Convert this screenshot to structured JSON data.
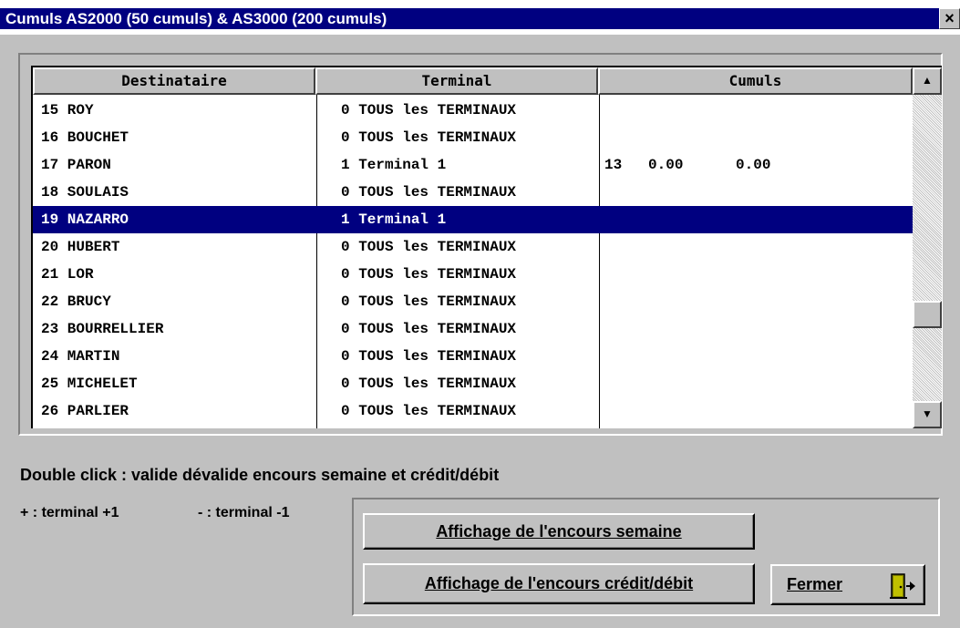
{
  "window": {
    "title": "Cumuls AS2000 (50 cumuls) & AS3000 (200 cumuls)",
    "close_glyph": "×"
  },
  "table": {
    "columns": [
      "Destinataire",
      "Terminal",
      "Cumuls"
    ],
    "rows": [
      {
        "dest": "15 ROY",
        "terminal": "0 TOUS les TERMINAUX",
        "cumuls": ""
      },
      {
        "dest": "16 BOUCHET",
        "terminal": "0 TOUS les TERMINAUX",
        "cumuls": ""
      },
      {
        "dest": "17 PARON",
        "terminal": "1 Terminal 1",
        "cumuls": "13   0.00      0.00"
      },
      {
        "dest": "18 SOULAIS",
        "terminal": "0 TOUS les TERMINAUX",
        "cumuls": ""
      },
      {
        "dest": "19 NAZARRO",
        "terminal": "1 Terminal 1",
        "cumuls": "",
        "selected": true
      },
      {
        "dest": "20 HUBERT",
        "terminal": "0 TOUS les TERMINAUX",
        "cumuls": ""
      },
      {
        "dest": "21 LOR",
        "terminal": "0 TOUS les TERMINAUX",
        "cumuls": ""
      },
      {
        "dest": "22 BRUCY",
        "terminal": "0 TOUS les TERMINAUX",
        "cumuls": ""
      },
      {
        "dest": "23 BOURRELLIER",
        "terminal": "0 TOUS les TERMINAUX",
        "cumuls": ""
      },
      {
        "dest": "24 MARTIN",
        "terminal": "0 TOUS les TERMINAUX",
        "cumuls": ""
      },
      {
        "dest": "25 MICHELET",
        "terminal": "0 TOUS les TERMINAUX",
        "cumuls": ""
      },
      {
        "dest": "26 PARLIER",
        "terminal": "0 TOUS les TERMINAUX",
        "cumuls": ""
      }
    ],
    "scroll_up_glyph": "▲",
    "scroll_down_glyph": "▼"
  },
  "hints": {
    "double_click": "Double click : valide dévalide encours semaine et crédit/débit",
    "plus": "+ : terminal +1",
    "minus": "- : terminal -1"
  },
  "buttons": {
    "encours_semaine": "Affichage de l'encours semaine",
    "encours_credit": "Affichage de l'encours crédit/débit",
    "fermer": "Fermer"
  },
  "icons": {
    "exit": "door-exit-icon"
  },
  "colors": {
    "title_bar": "#000080",
    "selection": "#000080",
    "face": "#c0c0c0"
  }
}
